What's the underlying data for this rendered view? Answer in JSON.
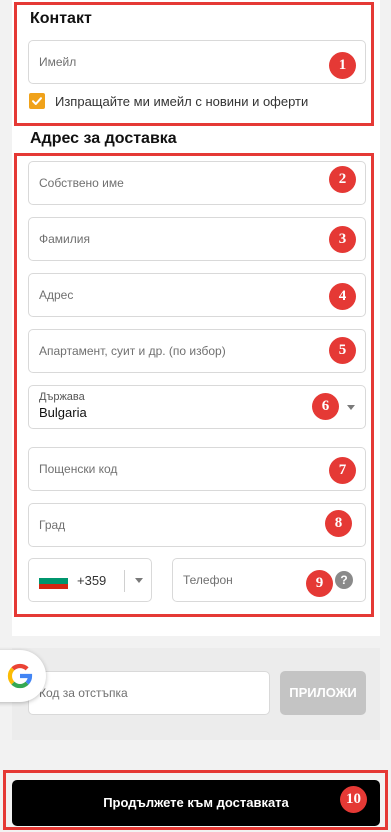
{
  "contact": {
    "heading": "Контакт",
    "email_placeholder": "Имейл",
    "newsletter_label": "Изпращайте ми имейл с новини и оферти",
    "newsletter_checked": true
  },
  "address": {
    "heading": "Адрес за доставка",
    "first_name_placeholder": "Собствено име",
    "last_name_placeholder": "Фамилия",
    "address_placeholder": "Адрес",
    "apartment_placeholder": "Апартамент, суит и др. (по избор)",
    "country_label": "Държава",
    "country_value": "Bulgaria",
    "postal_code_placeholder": "Пощенски код",
    "city_placeholder": "Град",
    "phone_code": "+359",
    "phone_placeholder": "Телефон",
    "help_symbol": "?"
  },
  "discount": {
    "placeholder": "Код за отстъпка",
    "apply_label": "ПРИЛОЖИ"
  },
  "continue_label": "Продължете към доставката",
  "annotations": [
    "1",
    "2",
    "3",
    "4",
    "5",
    "6",
    "7",
    "8",
    "9",
    "10"
  ],
  "colors": {
    "annotation_red": "#e53935",
    "checkbox_orange": "#f0a21a",
    "button_black": "#000000",
    "apply_disabled_gray": "#c4c4c4"
  },
  "icons": {
    "google": "google-g-icon",
    "flag": "bulgaria-flag-icon",
    "help": "question-mark-icon",
    "dropdown": "chevron-down-icon",
    "check": "checkmark-icon"
  }
}
